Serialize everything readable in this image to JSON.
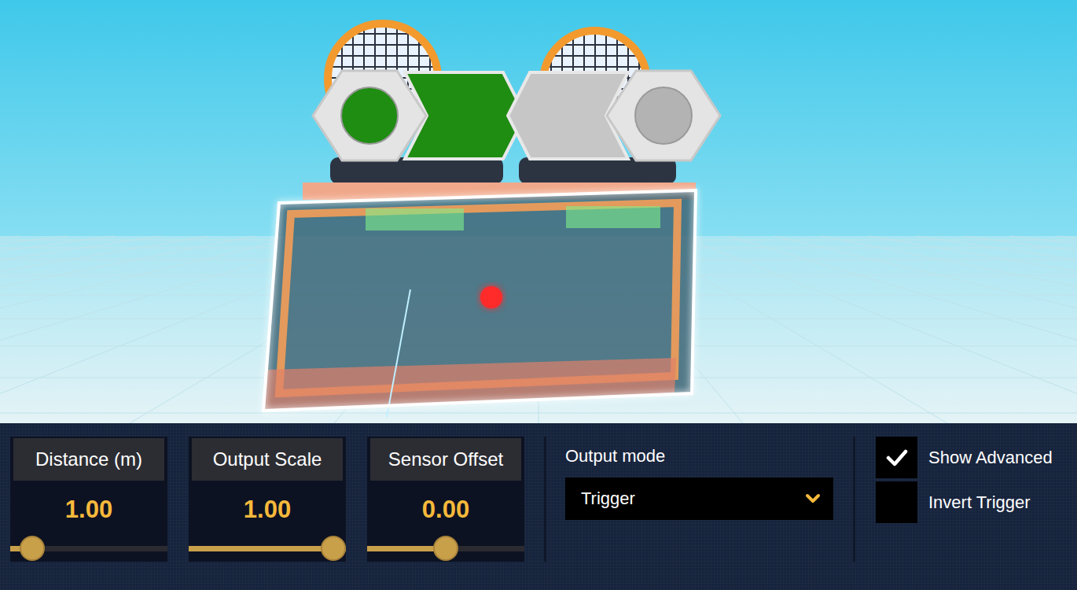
{
  "viewport": {
    "indicators": [
      {
        "on": true
      },
      {
        "on": false
      }
    ]
  },
  "sliders": [
    {
      "label": "Distance (m)",
      "value": "1.00",
      "level": 0.07
    },
    {
      "label": "Output Scale",
      "value": "1.00",
      "level": 1
    },
    {
      "label": "Sensor Offset",
      "value": "0.00",
      "level": 0.5
    }
  ],
  "output_mode": {
    "label": "Output mode",
    "value": "Trigger"
  },
  "checkboxes": [
    {
      "label": "Show Advanced",
      "checked": true
    },
    {
      "label": "Invert Trigger",
      "checked": false
    }
  ]
}
